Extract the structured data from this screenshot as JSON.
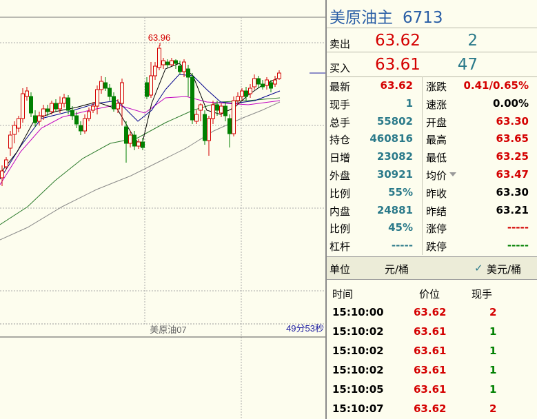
{
  "chart": {
    "high_label": "63.96",
    "contract_label": "美原油07",
    "countdown": "49分53秒",
    "colors": {
      "up": "#d40000",
      "down": "#008000",
      "ma1": "#000000",
      "ma2": "#00008b",
      "ma3": "#c000c0",
      "ma4": "#2a7a2a",
      "ma5": "#888888"
    }
  },
  "header": {
    "name": "美原油主",
    "code": "6713"
  },
  "ask": {
    "label": "卖出",
    "price": "63.62",
    "volume": "2"
  },
  "bid": {
    "label": "买入",
    "price": "63.61",
    "volume": "47"
  },
  "stats": [
    {
      "k1": "最新",
      "v1": "63.62",
      "c1": "red",
      "k2": "涨跌",
      "v2": "0.41/0.65%",
      "c2": "red"
    },
    {
      "k1": "现手",
      "v1": "1",
      "c1": "teal",
      "k2": "速涨",
      "v2": "0.00%",
      "c2": "blk"
    },
    {
      "k1": "总手",
      "v1": "55802",
      "c1": "teal",
      "k2": "开盘",
      "v2": "63.30",
      "c2": "red"
    },
    {
      "k1": "持仓",
      "v1": "460816",
      "c1": "teal",
      "k2": "最高",
      "v2": "63.65",
      "c2": "red"
    },
    {
      "k1": "日增",
      "v1": "23082",
      "c1": "teal",
      "k2": "最低",
      "v2": "63.25",
      "c2": "red"
    },
    {
      "k1": "外盘",
      "v1": "30921",
      "c1": "teal",
      "k2": "均价",
      "v2": "63.47",
      "c2": "red",
      "dropdown": true
    },
    {
      "k1": "比例",
      "v1": "55%",
      "c1": "teal",
      "k2": "昨收",
      "v2": "63.30",
      "c2": "blk"
    },
    {
      "k1": "内盘",
      "v1": "24881",
      "c1": "teal",
      "k2": "昨结",
      "v2": "63.21",
      "c2": "blk"
    },
    {
      "k1": "比例",
      "v1": "45%",
      "c1": "teal",
      "k2": "涨停",
      "v2": "-----",
      "c2": "red"
    },
    {
      "k1": "杠杆",
      "v1": "-----",
      "c1": "teal",
      "k2": "跌停",
      "v2": "-----",
      "c2": "grn"
    }
  ],
  "unit": {
    "label": "单位",
    "cny": "元/桶",
    "check": "✓",
    "usd": "美元/桶"
  },
  "trades": {
    "headers": {
      "time": "时间",
      "price": "价位",
      "vol": "现手"
    },
    "rows": [
      {
        "time": "15:10:00",
        "price": "63.62",
        "vol": "2"
      },
      {
        "time": "15:10:02",
        "price": "63.61",
        "vol": "1"
      },
      {
        "time": "15:10:02",
        "price": "63.61",
        "vol": "1"
      },
      {
        "time": "15:10:02",
        "price": "63.61",
        "vol": "1"
      },
      {
        "time": "15:10:05",
        "price": "63.61",
        "vol": "1"
      },
      {
        "time": "15:10:07",
        "price": "63.62",
        "vol": "2"
      }
    ]
  }
}
